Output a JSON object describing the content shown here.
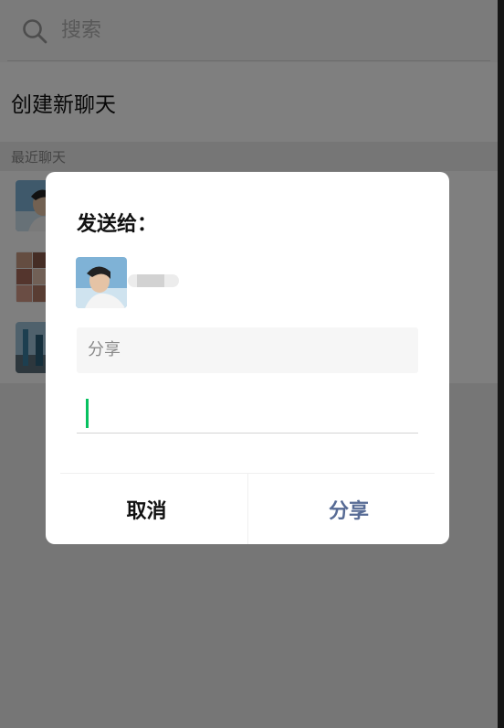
{
  "search": {
    "placeholder": "搜索",
    "icon": "search-icon"
  },
  "create_chat": {
    "label": "创建新聊天"
  },
  "recent": {
    "header": "最近聊天",
    "items": [
      {
        "avatar": "avatar-1"
      },
      {
        "avatar": "avatar-2"
      },
      {
        "avatar": "avatar-3"
      }
    ]
  },
  "dialog": {
    "title": "发送给：",
    "content_preview": "分享",
    "message_input": {
      "value": ""
    },
    "cancel_label": "取消",
    "share_label": "分享"
  },
  "colors": {
    "accent_link": "#576b95",
    "caret_green": "#07c160",
    "overlay": "rgba(0,0,0,0.5)"
  }
}
